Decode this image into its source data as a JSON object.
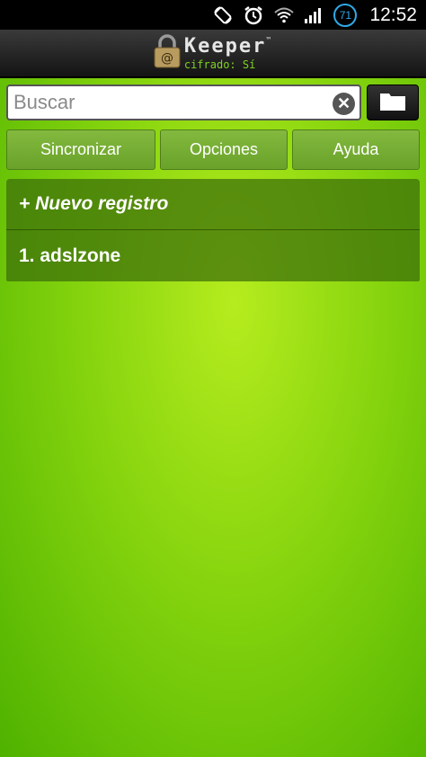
{
  "status_bar": {
    "time": "12:52",
    "battery_level": "71",
    "icons": [
      "rotate-icon",
      "alarm-icon",
      "wifi-icon",
      "signal-icon",
      "battery-icon"
    ]
  },
  "header": {
    "title": "Keeper",
    "trademark": "™",
    "subtitle": "cifrado: Sí"
  },
  "search": {
    "placeholder": "Buscar",
    "value": "",
    "clear_icon": "close-icon",
    "folder_icon": "folder-icon"
  },
  "toolbar": {
    "sync_label": "Sincronizar",
    "options_label": "Opciones",
    "help_label": "Ayuda"
  },
  "list": {
    "items": [
      {
        "label": "+ Nuevo registro"
      },
      {
        "label": "1. adslzone"
      }
    ]
  },
  "colors": {
    "background": "#86d40e",
    "accent_green": "#7fd321",
    "battery_blue": "#2fa9e8"
  }
}
